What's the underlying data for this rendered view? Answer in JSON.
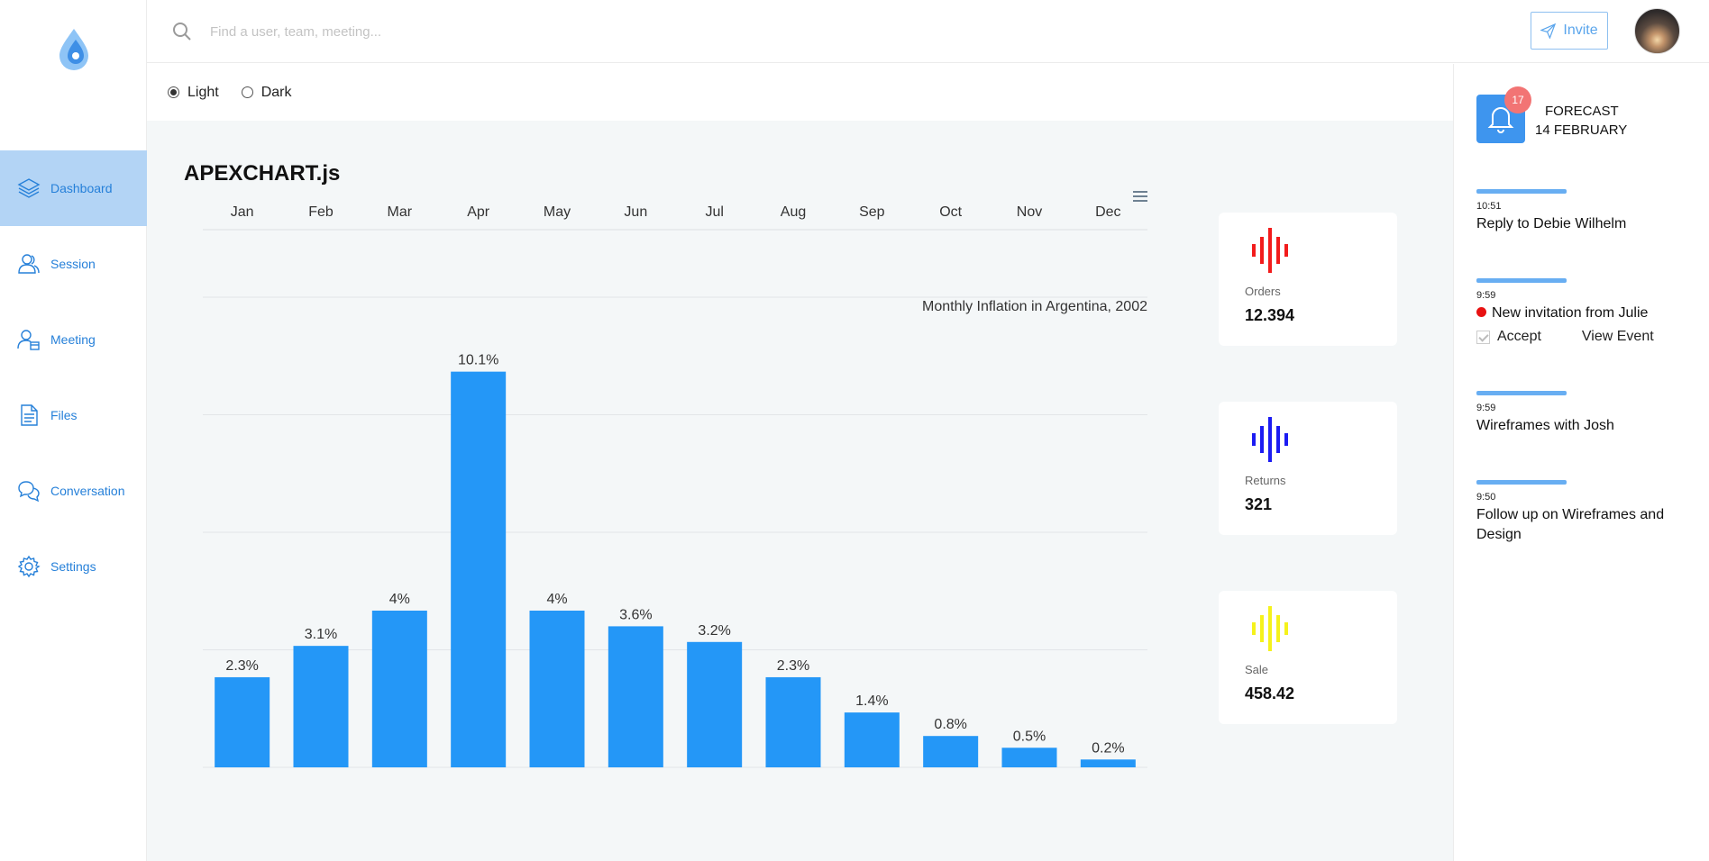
{
  "app": {
    "logo_icon": "droplet-logo-icon"
  },
  "search": {
    "placeholder": "Find a user, team, meeting...",
    "icon": "search-icon"
  },
  "header": {
    "invite_label": "Invite",
    "invite_icon": "paper-plane-icon",
    "accent": "#5aa5ec"
  },
  "sidebar": {
    "items": [
      {
        "label": "Dashboard",
        "icon": "layers-icon",
        "active": true
      },
      {
        "label": "Session",
        "icon": "users-icon",
        "active": false
      },
      {
        "label": "Meeting",
        "icon": "user-calendar-icon",
        "active": false
      },
      {
        "label": "Files",
        "icon": "document-icon",
        "active": false
      },
      {
        "label": "Conversation",
        "icon": "chat-bubbles-icon",
        "active": false
      },
      {
        "label": "Settings",
        "icon": "gear-icon",
        "active": false
      }
    ]
  },
  "theme": {
    "light_label": "Light",
    "dark_label": "Dark",
    "selected": "Light"
  },
  "chart": {
    "heading": "APEXCHART.js",
    "menu_icon": "hamburger-menu-icon"
  },
  "chart_data": {
    "type": "bar",
    "title": "Monthly Inflation in Argentina, 2002",
    "categories": [
      "Jan",
      "Feb",
      "Mar",
      "Apr",
      "May",
      "Jun",
      "Jul",
      "Aug",
      "Sep",
      "Oct",
      "Nov",
      "Dec"
    ],
    "values": [
      2.3,
      3.1,
      4.0,
      10.1,
      4.0,
      3.6,
      3.2,
      2.3,
      1.4,
      0.8,
      0.5,
      0.2
    ],
    "data_labels": [
      "2.3%",
      "3.1%",
      "4%",
      "10.1%",
      "4%",
      "3.6%",
      "3.2%",
      "2.3%",
      "1.4%",
      "0.8%",
      "0.5%",
      "0.2%"
    ],
    "ylim": [
      0,
      12
    ],
    "x_axis_position": "top",
    "y_axis_visible": false,
    "grid": true,
    "bar_color": "#2497f7"
  },
  "stats": [
    {
      "label": "Orders",
      "value": "12.394",
      "icon": "audio-wave-icon",
      "color": "#f21c1c"
    },
    {
      "label": "Returns",
      "value": "321",
      "icon": "audio-wave-icon",
      "color": "#1c1cf2"
    },
    {
      "label": "Sale",
      "value": "458.42",
      "icon": "audio-wave-icon",
      "color": "#f5f21c"
    }
  ],
  "notifications": {
    "badge_count": "17",
    "bell_icon": "bell-icon",
    "forecast_label": "FORECAST",
    "forecast_date": "14 FEBRUARY"
  },
  "events": [
    {
      "time": "10:51",
      "title": "Reply to Debie Wilhelm"
    },
    {
      "time": "9:59",
      "title": "New invitation from Julie",
      "accept_label": "Accept",
      "view_label": "View Event"
    },
    {
      "time": "9:59",
      "title": "Wireframes with Josh"
    },
    {
      "time": "9:50",
      "title": "Follow up on Wireframes and Design"
    }
  ]
}
